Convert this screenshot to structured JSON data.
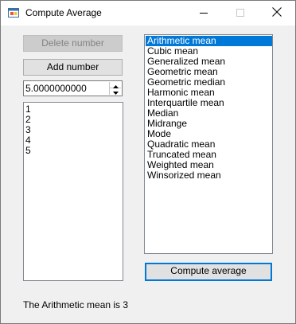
{
  "window": {
    "title": "Compute Average"
  },
  "left_panel": {
    "delete_button_label": "Delete number",
    "add_button_label": "Add number",
    "number_input_value": "5.0000000000",
    "numbers": [
      "1",
      "2",
      "3",
      "4",
      "5"
    ]
  },
  "right_panel": {
    "means": [
      "Arithmetic mean",
      "Cubic mean",
      "Generalized mean",
      "Geometric mean",
      "Geometric median",
      "Harmonic mean",
      "Interquartile mean",
      "Median",
      "Midrange",
      "Mode",
      "Quadratic mean",
      "Truncated mean",
      "Weighted mean",
      "Winsorized mean"
    ],
    "selected_index": 0,
    "compute_button_label": "Compute average"
  },
  "result_text": "The Arithmetic mean is 3",
  "colors": {
    "selection": "#0078d7",
    "focus_border": "#0078d7",
    "window_bg": "#f0f0f0"
  },
  "icons": {
    "app": "app-window-icon",
    "minimize": "minimize-icon",
    "maximize": "maximize-icon",
    "close": "close-icon",
    "spin_up": "chevron-up-icon",
    "spin_down": "chevron-down-icon"
  }
}
